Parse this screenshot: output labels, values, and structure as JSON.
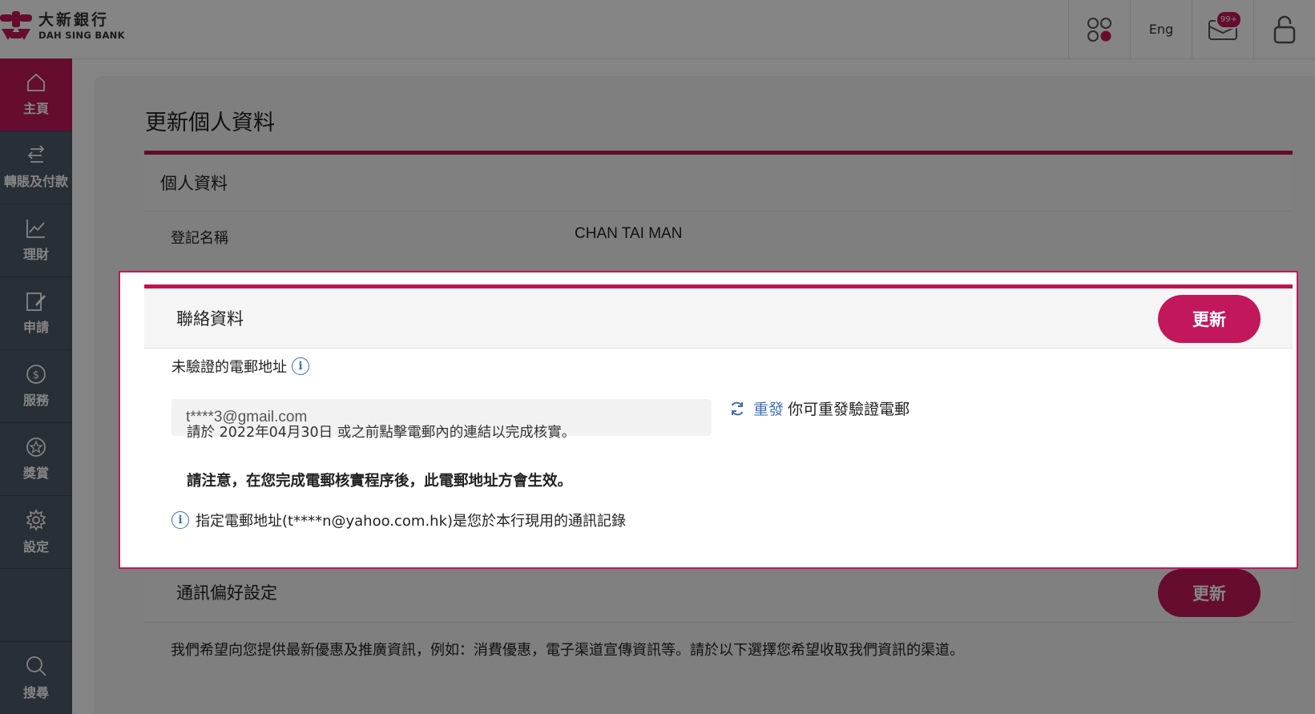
{
  "brand": {
    "name_cn": "大新銀行",
    "name_en": "DAH SING BANK",
    "color": "#c2185b"
  },
  "header": {
    "lang": "Eng",
    "mail_badge": "99+",
    "icons": [
      "apps-icon",
      "mail-icon",
      "lock-icon"
    ]
  },
  "sidebar": {
    "items": [
      {
        "label": "主頁",
        "icon": "home-icon",
        "active": true
      },
      {
        "label": "轉賬及付款",
        "icon": "transfer-icon"
      },
      {
        "label": "理財",
        "icon": "chart-icon"
      },
      {
        "label": "申請",
        "icon": "edit-icon"
      },
      {
        "label": "服務",
        "icon": "dollar-icon"
      },
      {
        "label": "獎賞",
        "icon": "star-icon"
      },
      {
        "label": "設定",
        "icon": "gear-icon"
      }
    ],
    "search_label": "搜尋"
  },
  "page": {
    "title": "更新個人資料",
    "personal": {
      "heading": "個人資料",
      "name_label": "登記名稱",
      "name_value": "CHAN TAI MAN"
    },
    "contact": {
      "heading": "聯絡資料",
      "update_label": "更新",
      "unverified_label": "未驗證的電郵地址",
      "email_value": "t****3@gmail.com",
      "resend_link": "重發",
      "resend_text": "你可重發驗證電郵",
      "deadline_note": "請於 2022年04月30日 或之前點擊電郵內的連結以完成核實。",
      "warning_note": "請注意，在您完成電郵核實程序後，此電郵地址方會生效。",
      "info_note": "指定電郵地址(t****n@yahoo.com.hk)是您於本行現用的通訊記錄"
    },
    "comm": {
      "heading": "通訊偏好設定",
      "update_label": "更新",
      "description": "我們希望向您提供最新優惠及推廣資訊，例如：消費優惠，電子渠道宣傳資訊等。請於以下選擇您希望收取我們資訊的渠道。"
    }
  }
}
